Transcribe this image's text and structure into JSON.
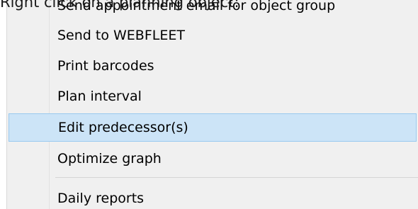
{
  "caption": "Right click on a planning object:",
  "menu": {
    "items": [
      {
        "label": "Send appointment email for object group",
        "highlighted": false
      },
      {
        "label": "Send to WEBFLEET",
        "highlighted": false
      },
      {
        "label": "Print barcodes",
        "highlighted": false
      },
      {
        "label": "Plan interval",
        "highlighted": false
      },
      {
        "label": "Edit predecessor(s)",
        "highlighted": true
      },
      {
        "label": "Optimize graph",
        "highlighted": false
      },
      {
        "label": "Daily reports",
        "highlighted": false
      }
    ]
  },
  "colors": {
    "menu_background": "#f0f0f0",
    "highlight_fill": "#cce4f7",
    "highlight_border": "#99c9ef",
    "separator": "#d5d5d5"
  }
}
